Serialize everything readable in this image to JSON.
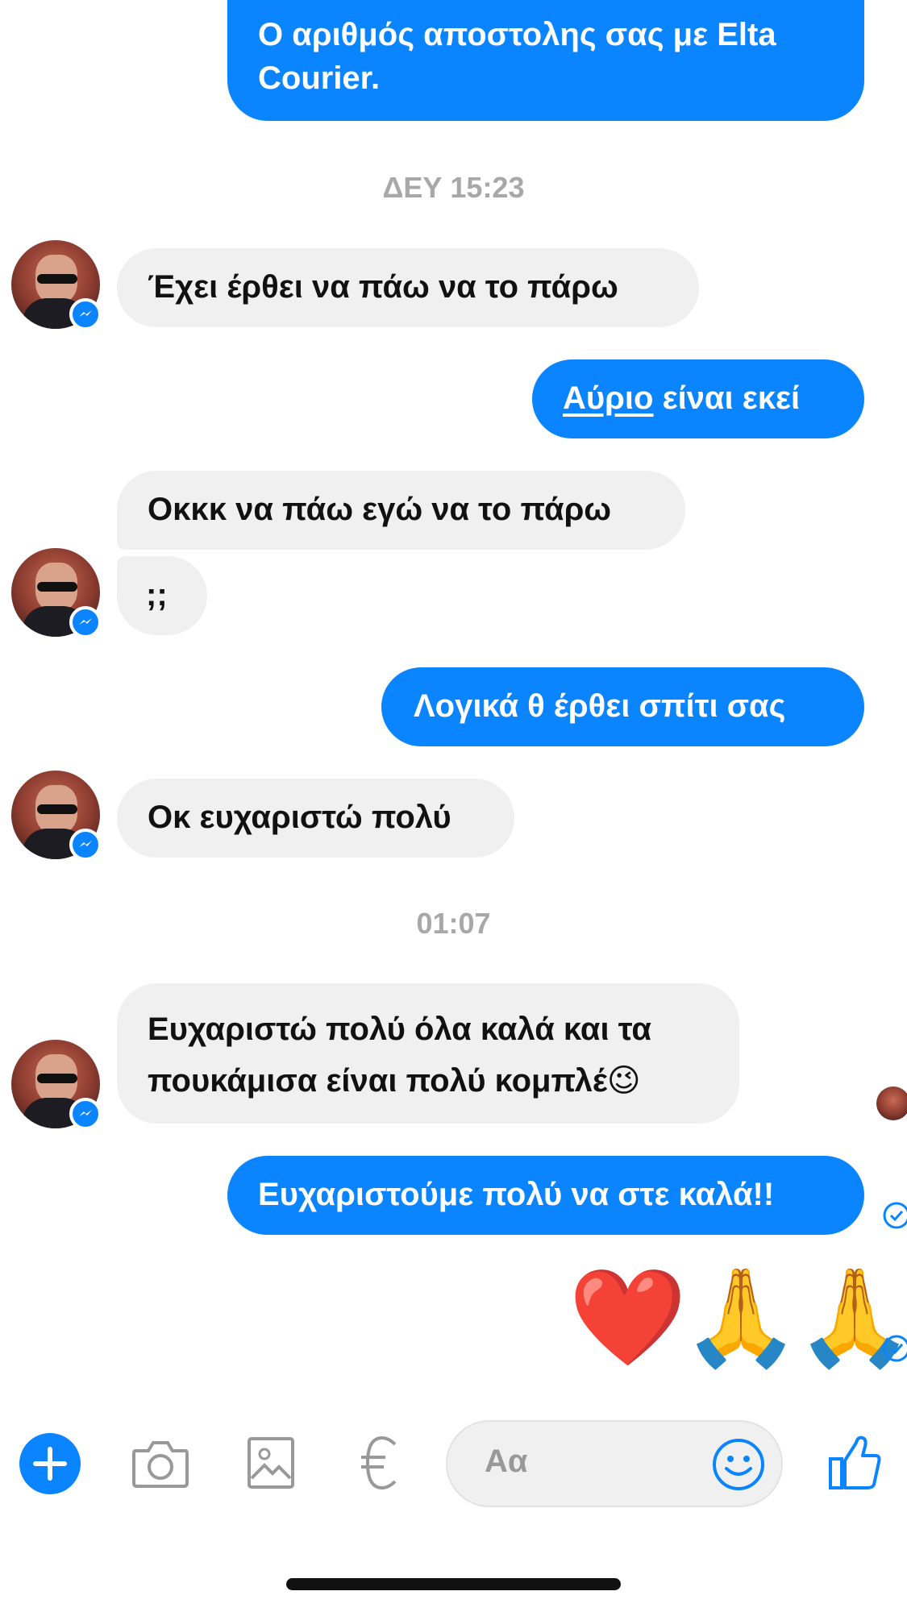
{
  "messages": {
    "m1_line1": "Ο αριθμός αποστολης σας με Elta",
    "m1_line2": "Courier.",
    "ts1": "ΔΕΥ 15:23",
    "m2": "Έχει έρθει να πάω να το πάρω",
    "m3_link": "Αύριο",
    "m3_rest": " είναι εκεί",
    "m4": "Οκκκ να πάω εγώ να το πάρω",
    "m5": ";;",
    "m6": "Λογικά θ έρθει σπίτι σας",
    "m7": "Οκ ευχαριστώ πολύ",
    "ts2": "01:07",
    "m8_line1": "Ευχαριστώ πολύ όλα καλά και τα",
    "m8_line2": "πουκάμισα είναι πολύ κομπλέ",
    "m8_emoji": "😉",
    "m9": "Ευχαριστούμε πολύ να στε καλά!!",
    "m10": "❤️🙏🙏"
  },
  "composer": {
    "placeholder": "Αα"
  },
  "colors": {
    "accent": "#0a84ff",
    "incoming_bg": "#f0f0f0",
    "timestamp": "#a8a8a8"
  },
  "icons": [
    "plus-icon",
    "camera-icon",
    "image-icon",
    "euro-icon",
    "emoji-icon",
    "thumbs-up-icon",
    "messenger-icon",
    "check-circle-icon"
  ]
}
